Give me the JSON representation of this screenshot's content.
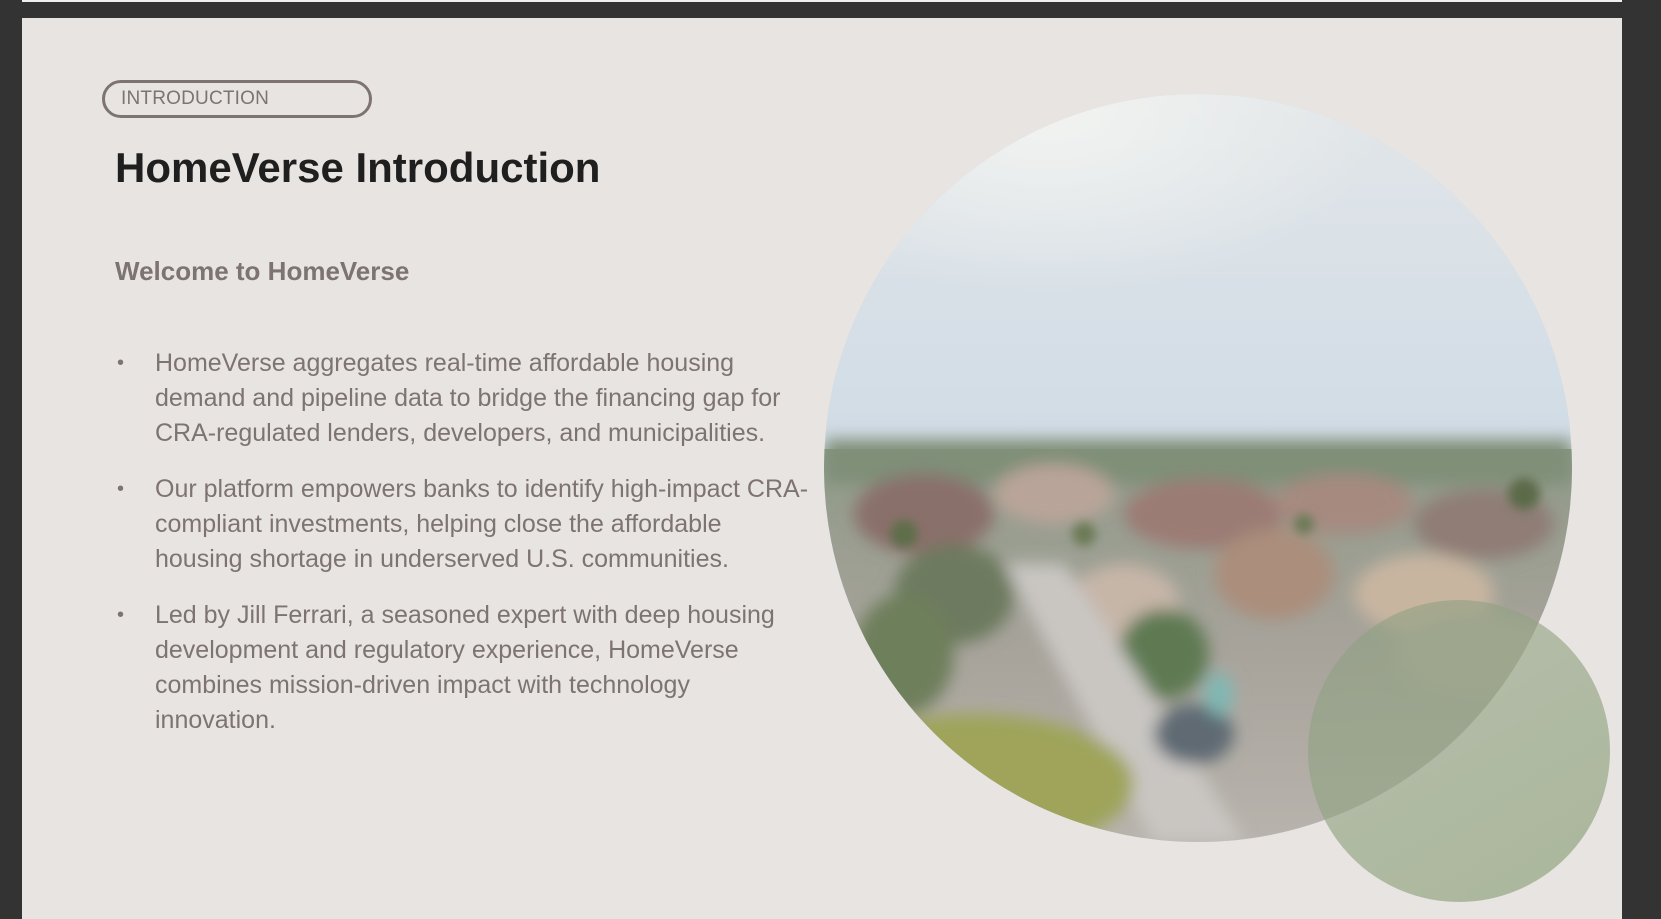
{
  "slide": {
    "section_label": "INTRODUCTION",
    "title": "HomeVerse Introduction",
    "subtitle": "Welcome to HomeVerse",
    "bullets": [
      "HomeVerse aggregates real-time affordable housing demand and pipeline data to bridge the financing gap for CRA-regulated lenders, developers, and municipalities.",
      "Our platform empowers banks to identify high-impact CRA-compliant investments, helping close the affordable housing shortage in underserved U.S. communities.",
      "Led by Jill Ferrari, a seasoned expert with deep housing development and regulatory experience, HomeVerse combines mission-driven impact with technology innovation."
    ],
    "bullet_glyph": "•"
  },
  "colors": {
    "window_frame": "#333333",
    "slide_background": "#e8e4e1",
    "title": "#1f1f1f",
    "accent_text": "#7d7372",
    "green_accent": "#96a884"
  },
  "images": {
    "hero": "blurred-aerial-suburban-neighborhood-photo"
  }
}
